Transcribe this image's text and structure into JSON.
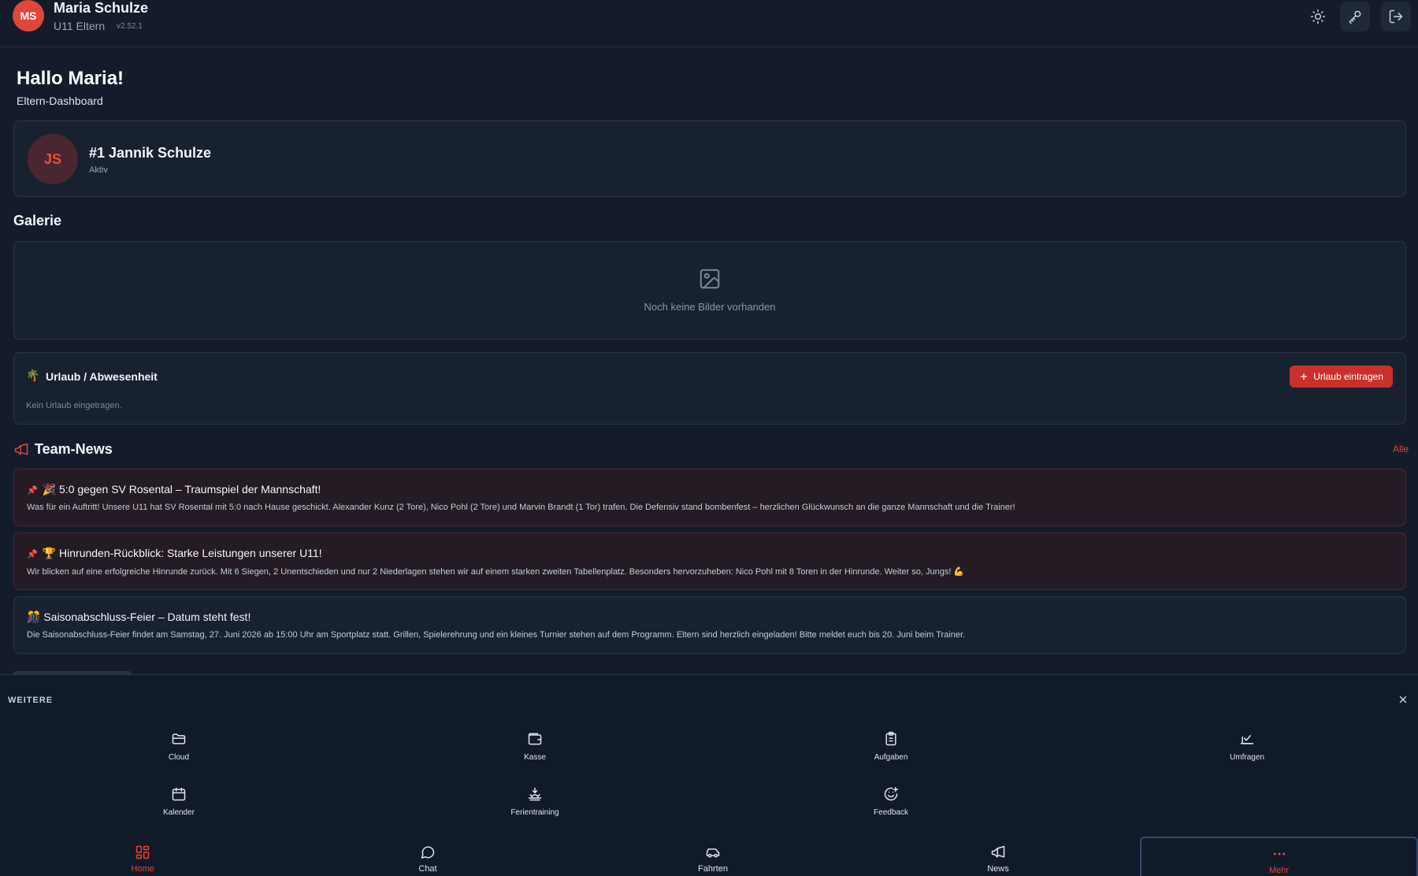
{
  "header": {
    "avatar_initials": "MS",
    "user_name": "Maria Schulze",
    "role": "U11 Eltern",
    "version": "v2.52.1",
    "actions": [
      "sun-icon",
      "key-icon",
      "logout-icon"
    ]
  },
  "greeting": "Hallo Maria!",
  "subtitle": "Eltern-Dashboard",
  "child": {
    "initials": "JS",
    "name": "#1 Jannik Schulze",
    "status": "Aktiv"
  },
  "gallery": {
    "title": "Galerie",
    "empty_text": "Noch keine Bilder vorhanden"
  },
  "vacation": {
    "icon": "🌴",
    "title": "Urlaub / Abwesenheit",
    "button_label": "Urlaub eintragen",
    "empty_text": "Kein Urlaub eingetragen."
  },
  "news": {
    "title": "Team-News",
    "all_link": "Alle",
    "items": [
      {
        "pinned": true,
        "pin": "📌",
        "title": "🎉 5:0 gegen SV Rosental – Traumspiel der Mannschaft!",
        "text": "Was für ein Auftritt! Unsere U11 hat SV Rosental mit 5:0 nach Hause geschickt. Alexander Kunz (2 Tore), Nico Pohl (2 Tore) und Marvin Brandt (1 Tor) trafen. Die Defensiv stand bombenfest – herzlichen Glückwunsch an die ganze Mannschaft und die Trainer!"
      },
      {
        "pinned": true,
        "pin": "📌",
        "title": "🏆 Hinrunden-Rückblick: Starke Leistungen unserer U11!",
        "text": "Wir blicken auf eine erfolgreiche Hinrunde zurück. Mit 6 Siegen, 2 Unentschieden und nur 2 Niederlagen stehen wir auf einem starken zweiten Tabellenplatz. Besonders hervorzuheben: Nico Pohl mit 8 Toren in der Hinrunde. Weiter so, Jungs! 💪"
      },
      {
        "pinned": false,
        "pin": "",
        "title": "🎊 Saisonabschluss-Feier – Datum steht fest!",
        "text": "Die Saisonabschluss-Feier findet am Samstag, 27. Juni 2026 ab 15:00 Uhr am Sportplatz statt. Grillen, Spielerehrung und ein kleines Turnier stehen auf dem Programm. Eltern sind herzlich eingeladen! Bitte meldet euch bis 20. Juni beim Trainer."
      }
    ]
  },
  "more_sheet": {
    "title": "WEITERE",
    "items": [
      {
        "label": "Cloud",
        "icon": "folder-icon"
      },
      {
        "label": "Kasse",
        "icon": "wallet-icon"
      },
      {
        "label": "Aufgaben",
        "icon": "clipboard-icon"
      },
      {
        "label": "Umfragen",
        "icon": "vote-icon"
      },
      {
        "label": "Kalender",
        "icon": "calendar-icon"
      },
      {
        "label": "Ferientraining",
        "icon": "sunset-icon"
      },
      {
        "label": "Feedback",
        "icon": "smile-plus-icon"
      }
    ]
  },
  "tabs": [
    {
      "label": "Home",
      "icon": "grid-icon",
      "active": true
    },
    {
      "label": "Chat",
      "icon": "chat-icon",
      "active": false
    },
    {
      "label": "Fahrten",
      "icon": "car-icon",
      "active": false
    },
    {
      "label": "News",
      "icon": "megaphone-icon",
      "active": false
    },
    {
      "label": "Mehr",
      "icon": "dots-icon",
      "active": true
    }
  ],
  "colors": {
    "accent": "#e0463a",
    "background": "#141c2c",
    "card": "#18212f",
    "pinned_card": "#241b24"
  }
}
